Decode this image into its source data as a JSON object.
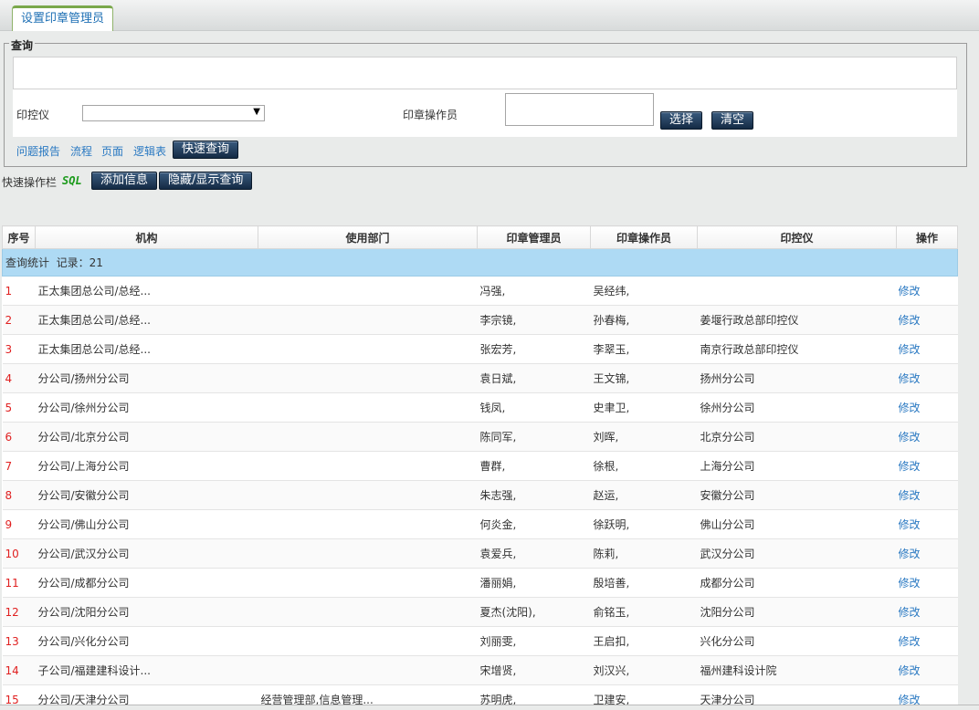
{
  "tab": {
    "title": "设置印章管理员"
  },
  "query": {
    "legend": "查询",
    "seal_device_label": "印控仪",
    "seal_device_value": "",
    "seal_operator_label": "印章操作员",
    "seal_operator_value": "",
    "select_button": "选择",
    "clear_button": "清空",
    "links": [
      "问题报告",
      "流程",
      "页面",
      "逻辑表"
    ],
    "quick_query_button": "快速查询"
  },
  "quickbar": {
    "label": "快速操作栏",
    "sql": "SQL",
    "add_button": "添加信息",
    "toggle_button": "隐藏/显示查询"
  },
  "table": {
    "headers": [
      "序号",
      "机构",
      "使用部门",
      "印章管理员",
      "印章操作员",
      "印控仪",
      "操作"
    ],
    "stat_label": "查询统计",
    "record_text": "记录：21",
    "rows": [
      {
        "seq": "1",
        "org": "正太集团总公司/总经...",
        "dept": "",
        "admin": "冯强,",
        "operator": "吴经纬,",
        "device": "",
        "op": "修改"
      },
      {
        "seq": "2",
        "org": "正太集团总公司/总经...",
        "dept": "",
        "admin": "李宗镜,",
        "operator": "孙春梅,",
        "device": "姜堰行政总部印控仪",
        "op": "修改"
      },
      {
        "seq": "3",
        "org": "正太集团总公司/总经...",
        "dept": "",
        "admin": "张宏芳,",
        "operator": "李翠玉,",
        "device": "南京行政总部印控仪",
        "op": "修改"
      },
      {
        "seq": "4",
        "org": "分公司/扬州分公司",
        "dept": "",
        "admin": "袁日斌,",
        "operator": "王文锦,",
        "device": "扬州分公司",
        "op": "修改"
      },
      {
        "seq": "5",
        "org": "分公司/徐州分公司",
        "dept": "",
        "admin": "钱凤,",
        "operator": "史聿卫,",
        "device": "徐州分公司",
        "op": "修改"
      },
      {
        "seq": "6",
        "org": "分公司/北京分公司",
        "dept": "",
        "admin": "陈同军,",
        "operator": "刘晖,",
        "device": "北京分公司",
        "op": "修改"
      },
      {
        "seq": "7",
        "org": "分公司/上海分公司",
        "dept": "",
        "admin": "曹群,",
        "operator": "徐根,",
        "device": "上海分公司",
        "op": "修改"
      },
      {
        "seq": "8",
        "org": "分公司/安徽分公司",
        "dept": "",
        "admin": "朱志强,",
        "operator": "赵运,",
        "device": "安徽分公司",
        "op": "修改"
      },
      {
        "seq": "9",
        "org": "分公司/佛山分公司",
        "dept": "",
        "admin": "何炎金,",
        "operator": "徐跃明,",
        "device": "佛山分公司",
        "op": "修改"
      },
      {
        "seq": "10",
        "org": "分公司/武汉分公司",
        "dept": "",
        "admin": "袁爱兵,",
        "operator": "陈莉,",
        "device": "武汉分公司",
        "op": "修改"
      },
      {
        "seq": "11",
        "org": "分公司/成都分公司",
        "dept": "",
        "admin": "潘丽娟,",
        "operator": "殷培善,",
        "device": "成都分公司",
        "op": "修改"
      },
      {
        "seq": "12",
        "org": "分公司/沈阳分公司",
        "dept": "",
        "admin": "夏杰(沈阳),",
        "operator": "俞铭玉,",
        "device": "沈阳分公司",
        "op": "修改"
      },
      {
        "seq": "13",
        "org": "分公司/兴化分公司",
        "dept": "",
        "admin": "刘丽雯,",
        "operator": "王启扣,",
        "device": "兴化分公司",
        "op": "修改"
      },
      {
        "seq": "14",
        "org": "子公司/福建建科设计...",
        "dept": "",
        "admin": "宋增贤,",
        "operator": "刘汉兴,",
        "device": "福州建科设计院",
        "op": "修改"
      },
      {
        "seq": "15",
        "org": "分公司/天津分公司",
        "dept": "经营管理部,信息管理...",
        "admin": "苏明虎,",
        "operator": "卫建安,",
        "device": "天津分公司",
        "op": "修改"
      }
    ]
  },
  "colors": {
    "accent": "#2a79c2",
    "seq": "#e02020",
    "stat_bg": "#aedaf4",
    "button": "#1f3a5c"
  }
}
